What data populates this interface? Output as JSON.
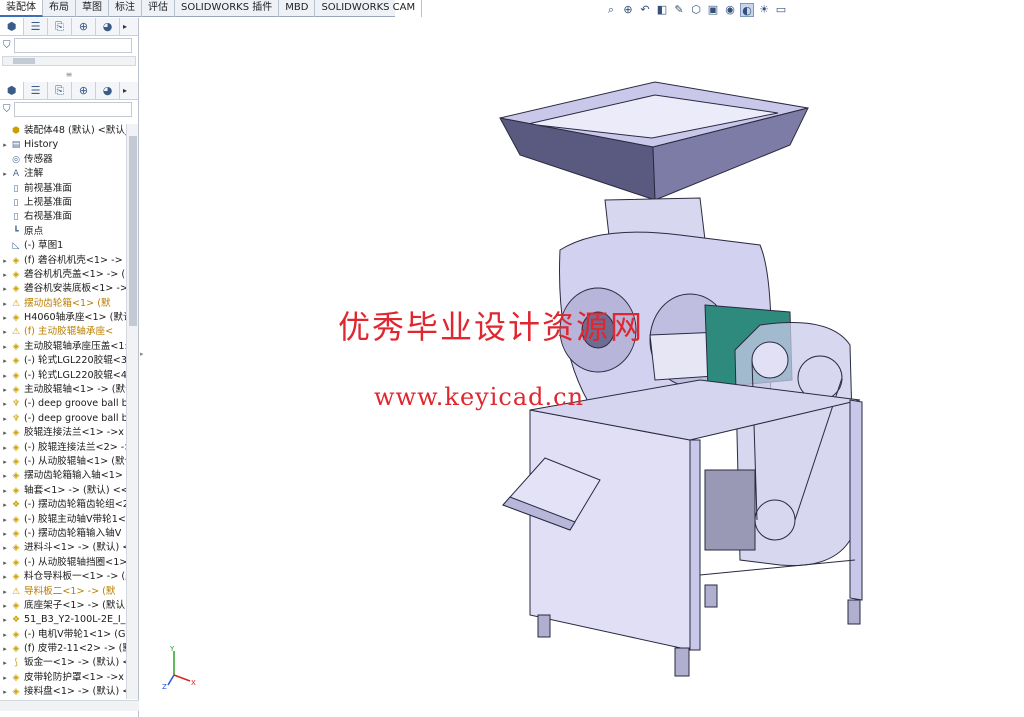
{
  "tabs": [
    "装配体",
    "布局",
    "草图",
    "标注",
    "评估",
    "SOLIDWORKS 插件",
    "MBD",
    "SOLIDWORKS CAM"
  ],
  "tree": [
    {
      "label": "装配体48 (默认) <默认_",
      "icon": "assembly-icon",
      "exp": ""
    },
    {
      "label": "History",
      "icon": "history-icon",
      "exp": "▸"
    },
    {
      "label": "传感器",
      "icon": "sensor-icon",
      "exp": ""
    },
    {
      "label": "注解",
      "icon": "annotation-icon",
      "exp": "▸"
    },
    {
      "label": "前视基准面",
      "icon": "plane-icon",
      "exp": ""
    },
    {
      "label": "上视基准面",
      "icon": "plane-icon",
      "exp": ""
    },
    {
      "label": "右视基准面",
      "icon": "plane-icon",
      "exp": ""
    },
    {
      "label": "原点",
      "icon": "origin-icon",
      "exp": ""
    },
    {
      "label": "(-) 草图1",
      "icon": "sketch-icon",
      "exp": ""
    },
    {
      "label": "(f) 砻谷机机壳<1> -> (",
      "icon": "part-icon",
      "exp": "▸"
    },
    {
      "label": "砻谷机机壳盖<1> -> (",
      "icon": "part-icon",
      "exp": "▸"
    },
    {
      "label": "砻谷机安装底板<1> ->",
      "icon": "part-icon",
      "exp": "▸"
    },
    {
      "label": "摆动齿轮箱<1> (默",
      "icon": "warn-icon",
      "exp": "▸",
      "warn": true
    },
    {
      "label": "H4060轴承座<1> (默认",
      "icon": "part-icon",
      "exp": "▸"
    },
    {
      "label": "(f) 主动胶辊轴承座<",
      "icon": "warn-icon",
      "exp": "▸",
      "warn": true
    },
    {
      "label": "主动胶辊轴承座压盖<1:",
      "icon": "part-icon",
      "exp": "▸"
    },
    {
      "label": "(-) 轮式LGL220胶辊<3:",
      "icon": "part-icon",
      "exp": "▸"
    },
    {
      "label": "(-) 轮式LGL220胶辊<4:",
      "icon": "part-icon",
      "exp": "▸"
    },
    {
      "label": "主动胶辊轴<1> -> (默认",
      "icon": "part-icon",
      "exp": "▸"
    },
    {
      "label": "(-) deep groove ball b",
      "icon": "bearing-icon",
      "exp": "▸"
    },
    {
      "label": "(-) deep groove ball b",
      "icon": "bearing-icon",
      "exp": "▸"
    },
    {
      "label": "胶辊连接法兰<1> ->x (",
      "icon": "part-icon",
      "exp": "▸"
    },
    {
      "label": "(-) 胶辊连接法兰<2> ->",
      "icon": "part-icon",
      "exp": "▸"
    },
    {
      "label": "(-) 从动胶辊轴<1> (默认",
      "icon": "part-icon",
      "exp": "▸"
    },
    {
      "label": "摆动齿轮箱输入轴<1> -",
      "icon": "part-icon",
      "exp": "▸"
    },
    {
      "label": "轴套<1> -> (默认) <<默",
      "icon": "part-icon",
      "exp": "▸"
    },
    {
      "label": "(-) 摆动齿轮箱齿轮组<2",
      "icon": "subasm-icon",
      "exp": "▸"
    },
    {
      "label": "(-) 胶辊主动轴V带轮1<",
      "icon": "part-icon",
      "exp": "▸"
    },
    {
      "label": "(-) 摆动齿轮箱输入轴V",
      "icon": "part-icon",
      "exp": "▸"
    },
    {
      "label": "进料斗<1> -> (默认) <",
      "icon": "part-icon",
      "exp": "▸"
    },
    {
      "label": "(-) 从动胶辊轴挡圈<1>",
      "icon": "part-icon",
      "exp": "▸"
    },
    {
      "label": "料仓导料板一<1> -> (默",
      "icon": "part-icon",
      "exp": "▸"
    },
    {
      "label": "导料板二<1> -> (默",
      "icon": "warn-icon",
      "exp": "▸",
      "warn": true
    },
    {
      "label": "底座架子<1> -> (默认<",
      "icon": "part-icon",
      "exp": "▸"
    },
    {
      "label": "51_B3_Y2-100L-2E_I_2",
      "icon": "subasm-icon",
      "exp": "▸"
    },
    {
      "label": "(-) 电机V带轮1<1> (Ge",
      "icon": "part-icon",
      "exp": "▸"
    },
    {
      "label": "(f) 皮带2-11<2> -> (默",
      "icon": "part-icon",
      "exp": "▸"
    },
    {
      "label": "钣金一<1> -> (默认) <",
      "icon": "sheetmetal-icon",
      "exp": "▸"
    },
    {
      "label": "皮带轮防护罩<1> ->x (",
      "icon": "part-icon",
      "exp": "▸"
    },
    {
      "label": "接料盘<1> -> (默认) <",
      "icon": "part-icon",
      "exp": "▸"
    }
  ],
  "watermark": {
    "line1": "优秀毕业设计资源网",
    "line2": "www.keyicad.cn"
  },
  "triad": {
    "x": "X",
    "y": "Y",
    "z": "Z"
  },
  "colors": {
    "machine_fill": "#d7d6f0",
    "machine_stroke": "#2a2a40",
    "motor": "#2f8a7e",
    "hopper_dark": "#55557a"
  }
}
